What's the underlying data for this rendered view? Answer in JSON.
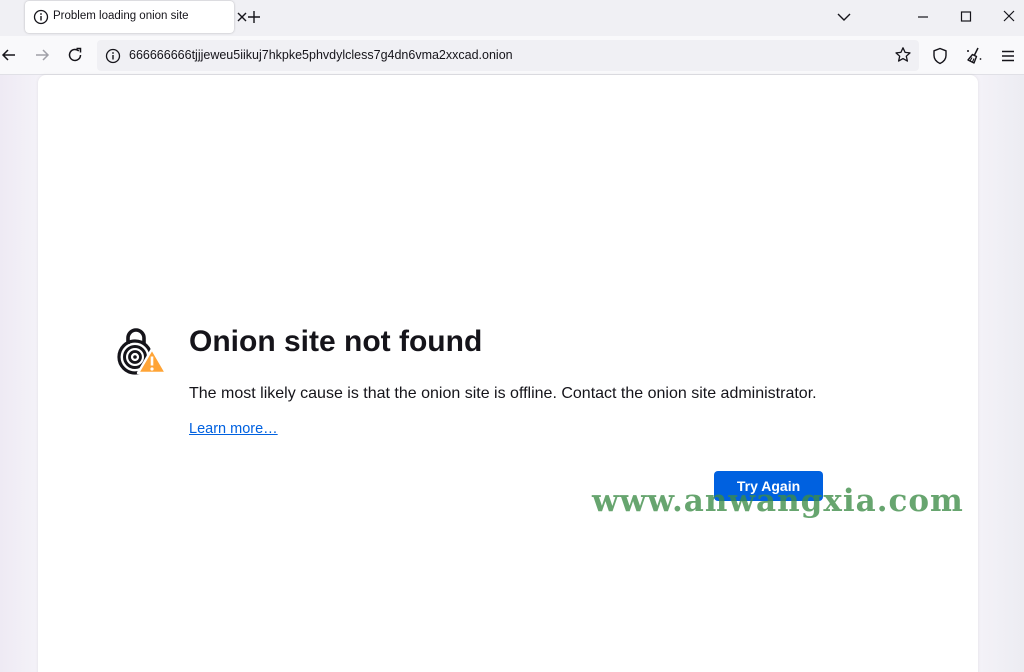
{
  "tab": {
    "title": "Problem loading onion site",
    "icon": "info-icon"
  },
  "urlbar": {
    "url": "666666666tjjjeweu5iikuj7hkpke5phvdylcless7g4dn6vma2xxcad.onion"
  },
  "error": {
    "icon": "onion-warning-icon",
    "title": "Onion site not found",
    "description": "The most likely cause is that the onion site is offline. Contact the onion site administrator.",
    "learn_more": "Learn more…",
    "button": "Try Again"
  },
  "watermark": "www.anwangxia.com",
  "colors": {
    "accent": "#0061e0",
    "warning": "#ffa436",
    "watermark": "#3c8c46"
  }
}
